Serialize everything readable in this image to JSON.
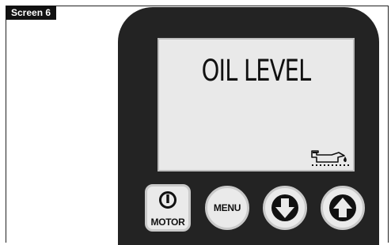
{
  "screen_tag": "Screen 6",
  "display": {
    "message": "OIL LEVEL",
    "indicator_icon": "oil-can-icon"
  },
  "buttons": {
    "motor": {
      "label": "MOTOR",
      "icon": "power-icon"
    },
    "menu": {
      "label": "MENU"
    },
    "down": {
      "icon": "arrow-down-icon"
    },
    "up": {
      "icon": "arrow-up-icon"
    }
  },
  "colors": {
    "bezel": "#232323",
    "lcd": "#e9e9e9",
    "button": "#eaeaea"
  }
}
